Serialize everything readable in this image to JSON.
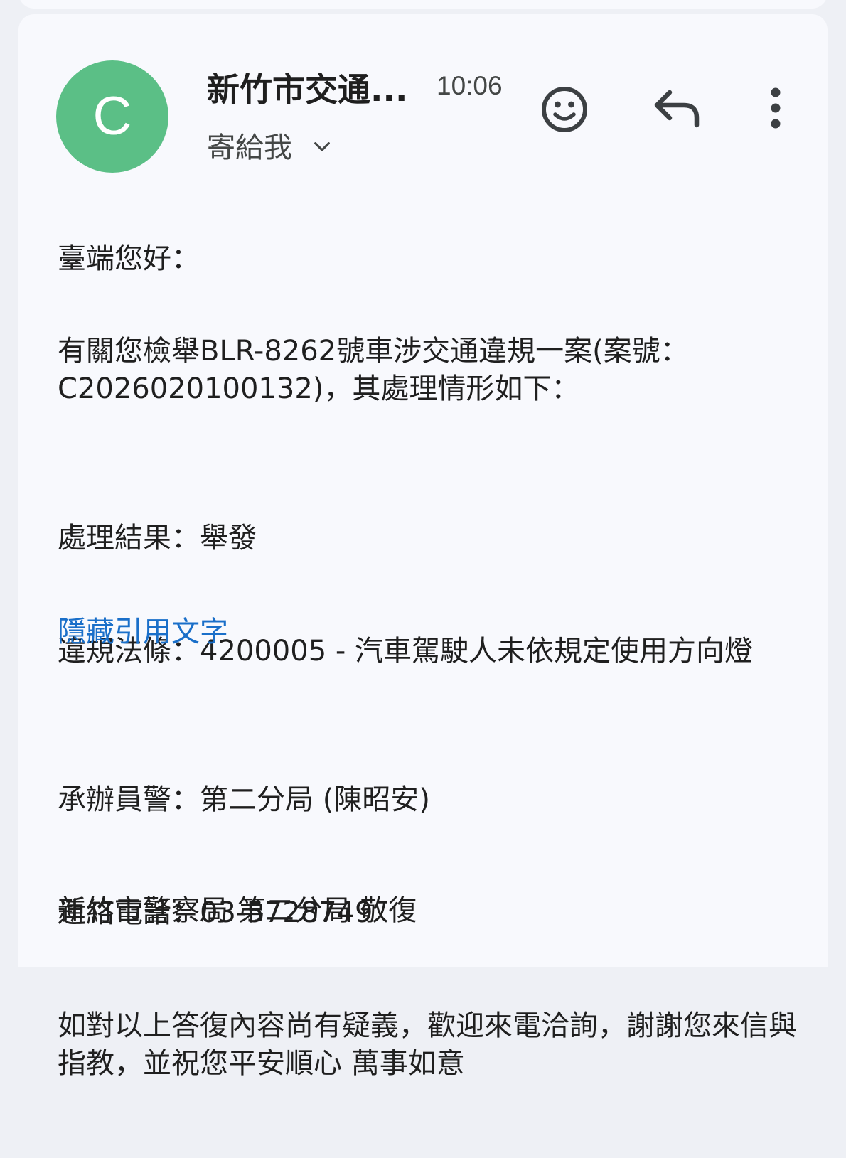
{
  "email": {
    "sender_initial": "C",
    "sender_name": "新竹市交通...",
    "time": "10:06",
    "recipient": "寄給我",
    "colors": {
      "avatar": "#5bbf86",
      "link": "#1a6fc9",
      "card": "#f8f9fd",
      "background": "#eef0f5"
    },
    "icons": {
      "emoji": "smiley-face-icon",
      "reply": "reply-arrow-icon",
      "more": "more-vertical-icon",
      "recipient_toggle": "chevron-down-icon"
    },
    "greeting": "臺端您好：",
    "paragraph1": "有關您檢舉BLR-8262號車涉交通違規一案(案號：C2026020100132)，其處理情形如下：",
    "result_line": "處理結果：舉發",
    "violation_line": "違規法條：4200005 - 汽車駕駛人未依規定使用方向燈",
    "hide_quoted_text": "隱藏引用文字",
    "officer_line": "承辦員警：第二分局 (陳昭安)",
    "phone_line": "連絡電話：03-5728749",
    "closing_line": "如對以上答復內容尚有疑義，歡迎來電洽詢，謝謝您來信與指教，並祝您平安順心 萬事如意",
    "signature": "新竹市警察局 第二分局 敬復"
  }
}
